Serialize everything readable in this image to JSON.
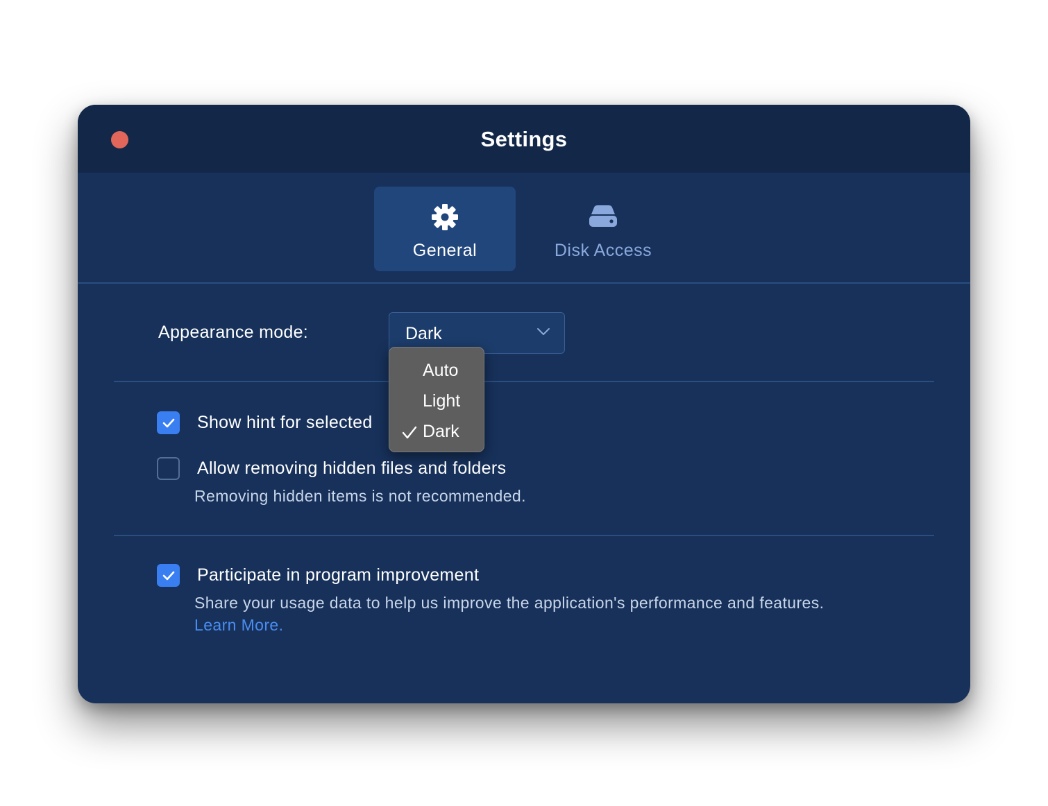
{
  "window": {
    "title": "Settings"
  },
  "tabs": [
    {
      "label": "General",
      "icon": "gear-icon",
      "active": true
    },
    {
      "label": "Disk Access",
      "icon": "disk-icon",
      "active": false
    }
  ],
  "appearance": {
    "label": "Appearance mode:",
    "selected": "Dark",
    "options": [
      "Auto",
      "Light",
      "Dark"
    ]
  },
  "options": {
    "show_hint": {
      "label": "Show hint for selected",
      "checked": true
    },
    "allow_hidden": {
      "label": "Allow removing hidden files and folders",
      "description": "Removing hidden items is not recommended.",
      "checked": false
    },
    "improvement": {
      "label": "Participate in program improvement",
      "description": "Share your usage data to help us improve the application's performance and features.",
      "link": "Learn More.",
      "checked": true
    }
  },
  "colors": {
    "window_bg": "#17315a",
    "titlebar_bg": "#132848",
    "accent": "#3a7ff2",
    "link": "#4a8df2",
    "close": "#e2675a"
  }
}
